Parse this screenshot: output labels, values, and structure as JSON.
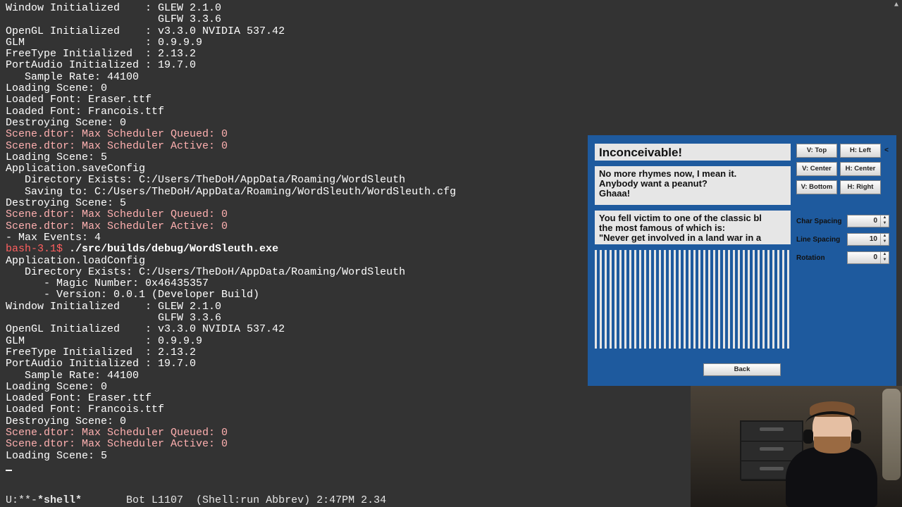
{
  "terminal": {
    "lines": [
      {
        "t": "Window Initialized    : GLEW 2.1.0"
      },
      {
        "t": "                        GLFW 3.3.6"
      },
      {
        "t": "OpenGL Initialized    : v3.3.0 NVIDIA 537.42"
      },
      {
        "t": "GLM                   : 0.9.9.9"
      },
      {
        "t": "FreeType Initialized  : 2.13.2"
      },
      {
        "t": "PortAudio Initialized : 19.7.0"
      },
      {
        "t": "   Sample Rate: 44100"
      },
      {
        "t": "Loading Scene: 0"
      },
      {
        "t": "Loaded Font: Eraser.ttf"
      },
      {
        "t": "Loaded Font: Francois.ttf"
      },
      {
        "t": "Destroying Scene: 0"
      },
      {
        "t": "Scene.dtor: Max Scheduler Queued: 0",
        "c": "pink"
      },
      {
        "t": "Scene.dtor: Max Scheduler Active: 0",
        "c": "pink"
      },
      {
        "t": "Loading Scene: 5"
      },
      {
        "t": "Application.saveConfig"
      },
      {
        "t": "   Directory Exists: C:/Users/TheDoH/AppData/Roaming/WordSleuth"
      },
      {
        "t": "   Saving to: C:/Users/TheDoH/AppData/Roaming/WordSleuth/WordSleuth.cfg"
      },
      {
        "t": "Destroying Scene: 5"
      },
      {
        "t": "Scene.dtor: Max Scheduler Queued: 0",
        "c": "pink"
      },
      {
        "t": "Scene.dtor: Max Scheduler Active: 0",
        "c": "pink"
      },
      {
        "t": "- Max Events: 4"
      }
    ],
    "prompt": {
      "ps1": "bash-3.1$ ",
      "cmd": "./src/builds/debug/WordSleuth.exe"
    },
    "lines2": [
      {
        "t": "Application.loadConfig"
      },
      {
        "t": "   Directory Exists: C:/Users/TheDoH/AppData/Roaming/WordSleuth"
      },
      {
        "t": "      - Magic Number: 0x46435357"
      },
      {
        "t": "      - Version: 0.0.1 (Developer Build)"
      },
      {
        "t": "Window Initialized    : GLEW 2.1.0"
      },
      {
        "t": "                        GLFW 3.3.6"
      },
      {
        "t": "OpenGL Initialized    : v3.3.0 NVIDIA 537.42"
      },
      {
        "t": "GLM                   : 0.9.9.9"
      },
      {
        "t": "FreeType Initialized  : 2.13.2"
      },
      {
        "t": "PortAudio Initialized : 19.7.0"
      },
      {
        "t": "   Sample Rate: 44100"
      },
      {
        "t": "Loading Scene: 0"
      },
      {
        "t": "Loaded Font: Eraser.ttf"
      },
      {
        "t": "Loaded Font: Francois.ttf"
      },
      {
        "t": "Destroying Scene: 0"
      },
      {
        "t": "Scene.dtor: Max Scheduler Queued: 0",
        "c": "pink"
      },
      {
        "t": "Scene.dtor: Max Scheduler Active: 0",
        "c": "pink"
      },
      {
        "t": "Loading Scene: 5"
      }
    ]
  },
  "statusbar": {
    "left": "U:**-",
    "buffer": "*shell*",
    "right": "       Bot L1107  (Shell:run Abbrev) 2:47PM 2.34"
  },
  "app": {
    "title": "Inconceivable!",
    "body": "No more rhymes now, I mean it.\nAnybody want a peanut?\nGhaaa!",
    "body2": "You fell victim to one of the classic bl\nthe most famous of which is:\n\"Never get involved in a land war in a",
    "buttons": {
      "vtop": "V: Top",
      "hleft": "H: Left",
      "vcenter": "V: Center",
      "hcenter": "H: Center",
      "vbottom": "V: Bottom",
      "hright": "H: Right"
    },
    "props": {
      "charSpacing": {
        "label": "Char Spacing",
        "value": "0"
      },
      "lineSpacing": {
        "label": "Line Spacing",
        "value": "10"
      },
      "rotation": {
        "label": "Rotation",
        "value": "0"
      }
    },
    "back": "Back",
    "marker": "<"
  }
}
